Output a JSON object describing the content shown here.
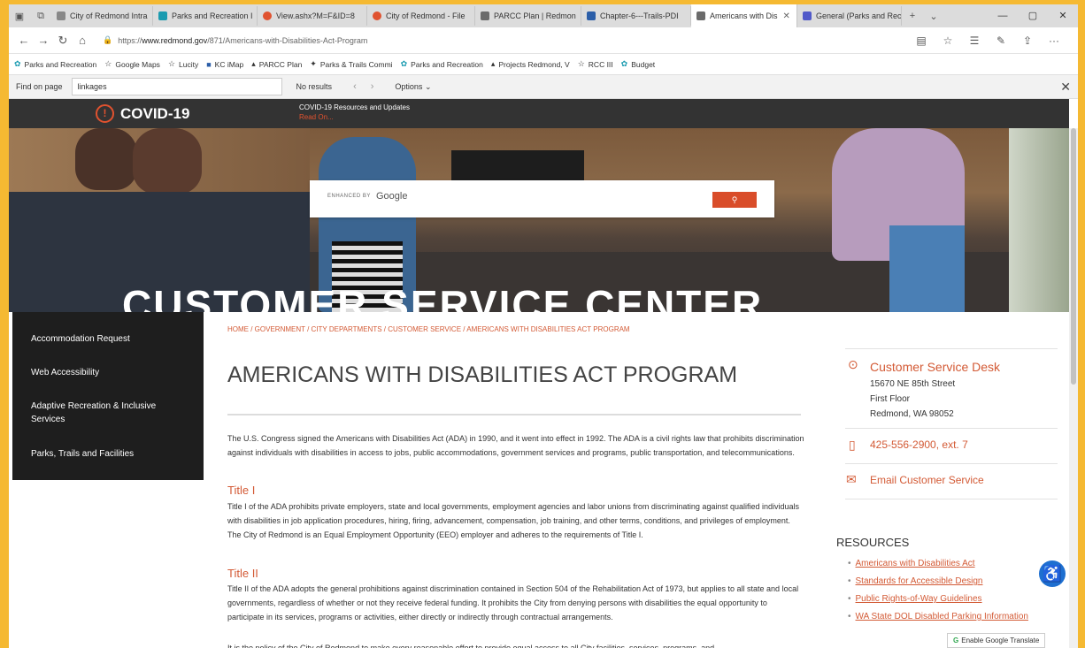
{
  "tabs": [
    {
      "label": "City of Redmond Intra",
      "color": "#888888"
    },
    {
      "label": "Parks and Recreation I",
      "color": "#1a9bb0"
    },
    {
      "label": "View.ashx?M=F&ID=8",
      "color": "#e0522f"
    },
    {
      "label": "City of Redmond - File",
      "color": "#e0522f"
    },
    {
      "label": "PARCC Plan | Redmon",
      "color": "#6b6b6b"
    },
    {
      "label": "Chapter-6---Trails-PDI",
      "color": "#2b5ea8"
    },
    {
      "label": "Americans with Dis",
      "color": "#6b6b6b"
    },
    {
      "label": "General (Parks and Rec",
      "color": "#5059c9"
    }
  ],
  "address": {
    "prefix": "https://",
    "domain": "www.redmond.gov",
    "path": "/871/Americans-with-Disabilities-Act-Program"
  },
  "favorites": [
    "Parks and Recreation",
    "Google Maps",
    "Lucity",
    "KC iMap",
    "PARCC Plan",
    "Parks & Trails Commi",
    "Parks and Recreation",
    "Projects Redmond, V",
    "RCC III",
    "Budget"
  ],
  "findbar": {
    "label": "Find on page",
    "query": "linkages",
    "result": "No results",
    "options": "Options"
  },
  "covid": {
    "title": "COVID-19",
    "resources": "COVID-19 Resources and Updates",
    "more": "Read On..."
  },
  "hero": {
    "title": "CUSTOMER SERVICE CENTER",
    "search_label": "ENHANCED BY",
    "search_brand": "Google"
  },
  "leftnav": [
    "Accommodation Request",
    "Web Accessibility",
    "Adaptive Recreation & Inclusive Services",
    "Parks, Trails and Facilities"
  ],
  "breadcrumb": "HOME / GOVERNMENT / CITY DEPARTMENTS / CUSTOMER SERVICE / AMERICANS WITH DISABILITIES ACT PROGRAM",
  "title": "AMERICANS WITH DISABILITIES ACT PROGRAM",
  "intro": "The U.S. Congress signed the Americans with Disabilities Act (ADA) in 1990, and it went into effect in 1992. The ADA is a civil rights law that prohibits discrimination against individuals with disabilities in access to jobs, public accommodations, government services and programs, public transportation, and telecommunications.",
  "title1": {
    "heading": "Title I",
    "body": "Title I of the ADA prohibits private employers, state and local governments, employment agencies and labor unions from discriminating against qualified individuals with disabilities in job application procedures, hiring, firing, advancement, compensation, job training, and other terms, conditions, and privileges of employment. The City of Redmond is an Equal Employment Opportunity (EEO) employer and adheres to the requirements of Title I."
  },
  "title2": {
    "heading": "Title II",
    "body": "Title II of the ADA adopts the general prohibitions against discrimination contained in Section 504 of the Rehabilitation Act of 1973, but applies to all state and local governments, regardless of whether or not they receive federal funding. It prohibits the City from denying persons with disabilities the equal opportunity to participate in its services, programs or activities, either directly or indirectly through contractual arrangements."
  },
  "trailing": "It is the policy of the City of Redmond to make every reasonable effort to provide equal access to all City facilities, services, programs, and",
  "contact": {
    "title": "Customer Service Desk",
    "street": "15670 NE 85th Street",
    "floor": "First Floor",
    "city": "Redmond, WA 98052",
    "phone": "425-556-2900, ext. 7",
    "email": "Email Customer Service"
  },
  "resources": {
    "heading": "RESOURCES",
    "items": [
      "Americans with Disabilities Act",
      "Standards for Accessible Design",
      "Public Rights-of-Way Guidelines",
      "WA State DOL Disabled Parking Information"
    ]
  },
  "translate": "Enable Google Translate",
  "colors": {
    "accent": "#d35a35",
    "frame": "#f5b932",
    "nav_bg": "#1e1e1e"
  }
}
